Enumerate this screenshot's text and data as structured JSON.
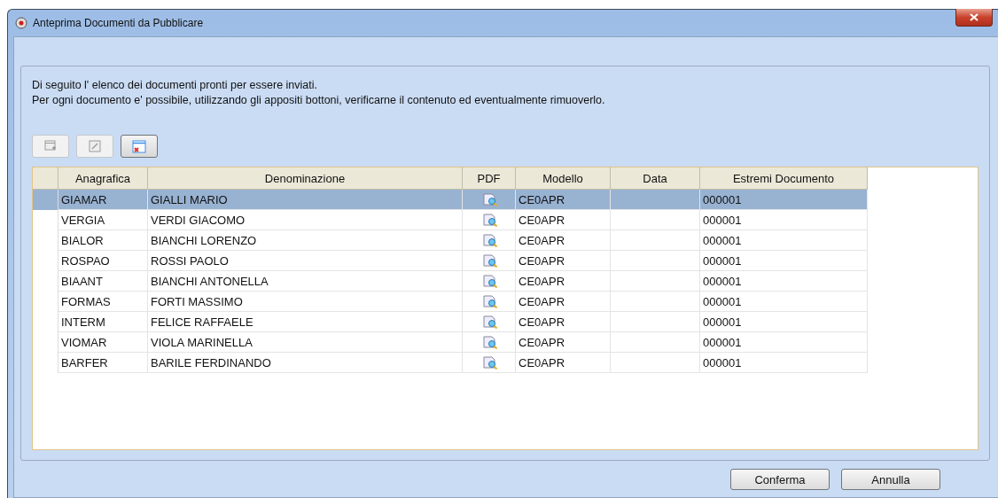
{
  "window": {
    "title": "Anteprima Documenti da Pubblicare"
  },
  "intro": [
    "Di seguito l' elenco dei documenti pronti per essere inviati.",
    "Per ogni documento e' possibile, utilizzando gli appositi bottoni, verificarne il contenuto ed eventualmente rimuoverlo."
  ],
  "toolbar": [
    {
      "kind": "add",
      "disabled": true
    },
    {
      "kind": "edit",
      "disabled": true
    },
    {
      "kind": "remove",
      "disabled": false
    }
  ],
  "table": {
    "columns": [
      "Anagrafica",
      "Denominazione",
      "PDF",
      "Modello",
      "Data",
      "Estremi Documento"
    ],
    "rows": [
      {
        "anagrafica": "GIAMAR",
        "denominazione": "GIALLI MARIO",
        "modello": "CE0APR",
        "estremi": "000001",
        "selected": true
      },
      {
        "anagrafica": "VERGIA",
        "denominazione": "VERDI GIACOMO",
        "modello": "CE0APR",
        "estremi": "000001",
        "selected": false
      },
      {
        "anagrafica": "BIALOR",
        "denominazione": "BIANCHI LORENZO",
        "modello": "CE0APR",
        "estremi": "000001",
        "selected": false
      },
      {
        "anagrafica": "ROSPAO",
        "denominazione": "ROSSI PAOLO",
        "modello": "CE0APR",
        "estremi": "000001",
        "selected": false
      },
      {
        "anagrafica": "BIAANT",
        "denominazione": "BIANCHI ANTONELLA",
        "modello": "CE0APR",
        "estremi": "000001",
        "selected": false
      },
      {
        "anagrafica": "FORMAS",
        "denominazione": "FORTI MASSIMO",
        "modello": "CE0APR",
        "estremi": "000001",
        "selected": false
      },
      {
        "anagrafica": "INTERM",
        "denominazione": "FELICE RAFFAELE",
        "modello": "CE0APR",
        "estremi": "000001",
        "selected": false
      },
      {
        "anagrafica": "VIOMAR",
        "denominazione": "VIOLA MARINELLA",
        "modello": "CE0APR",
        "estremi": "000001",
        "selected": false
      },
      {
        "anagrafica": "BARFER",
        "denominazione": "BARILE FERDINANDO",
        "modello": "CE0APR",
        "estremi": "000001",
        "selected": false
      }
    ]
  },
  "buttons": [
    "Conferma",
    "Annulla"
  ]
}
